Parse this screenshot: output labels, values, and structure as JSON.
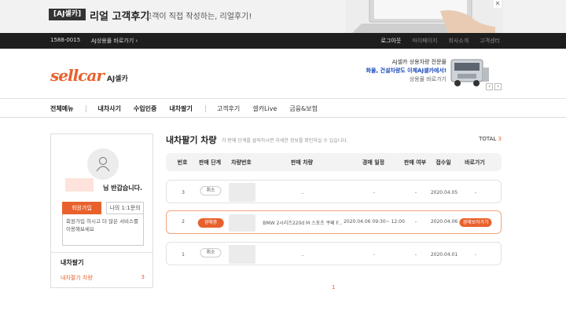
{
  "banner": {
    "tag": "[AJ셀카]",
    "title": "리얼 고객후기",
    "subtitle": "고객이 직접 작성하는, 리얼후기!"
  },
  "topbar": {
    "phone": "1588-0015",
    "shop_link": "AJ상용몰 바로가기",
    "links": [
      "로그아웃",
      "마이페이지",
      "회사소개",
      "고객센터"
    ]
  },
  "logo": {
    "brand": "sellcar",
    "sub": "AJ셀카"
  },
  "header_ad": {
    "line1": "AJ셀카 상용차량 전문몰",
    "line2": "화물, 건설차량도 이제AJ셀카에서!",
    "line3": "상용몰 바로가기"
  },
  "nav": {
    "items": [
      "전체메뉴",
      "내차사기",
      "수입인증",
      "내차팔기",
      "고객후기",
      "셀카Live",
      "금융&보험"
    ]
  },
  "sidebar": {
    "greeting": "님 반갑습니다.",
    "join_label": "회원가입",
    "qna_label": "나의 1:1문의",
    "join_note": "회원가입 하시고 더 많은 서비스를 이용해보세요",
    "section_title": "내차팔기",
    "link_label": "내차팔기 차량",
    "link_count": "3"
  },
  "main": {
    "title": "내차팔기 차량",
    "desc": "각 판매 단계를 클릭하시면 자세한 정보를 확인하실 수 있습니다.",
    "total_label": "TOTAL",
    "total_count": "3",
    "columns": [
      "번호",
      "판매 단계",
      "차량번호",
      "판매 차량",
      "경매 일정",
      "판매 여부",
      "접수일",
      "바로가기"
    ],
    "rows": [
      {
        "no": "3",
        "stage": "취소",
        "car": "..",
        "schedule": "-",
        "sold": "-",
        "date": "2020.04.05",
        "go": "-"
      },
      {
        "no": "2",
        "stage": "경매중",
        "car": "BMW 2시리즈220d M 스포츠 쿠페 F...",
        "schedule": "2020.04.06 09:30~ 12:00",
        "sold": "-",
        "date": "2020.04.06",
        "go": "경매보러가기"
      },
      {
        "no": "1",
        "stage": "취소",
        "car": "..",
        "schedule": "-",
        "sold": "-",
        "date": "2020.04.01",
        "go": "-"
      }
    ]
  },
  "pagination": {
    "current": "1"
  },
  "colors": {
    "accent": "#e8612c",
    "topbar": "#1e1e1e",
    "link_blue": "#1a49b8"
  }
}
